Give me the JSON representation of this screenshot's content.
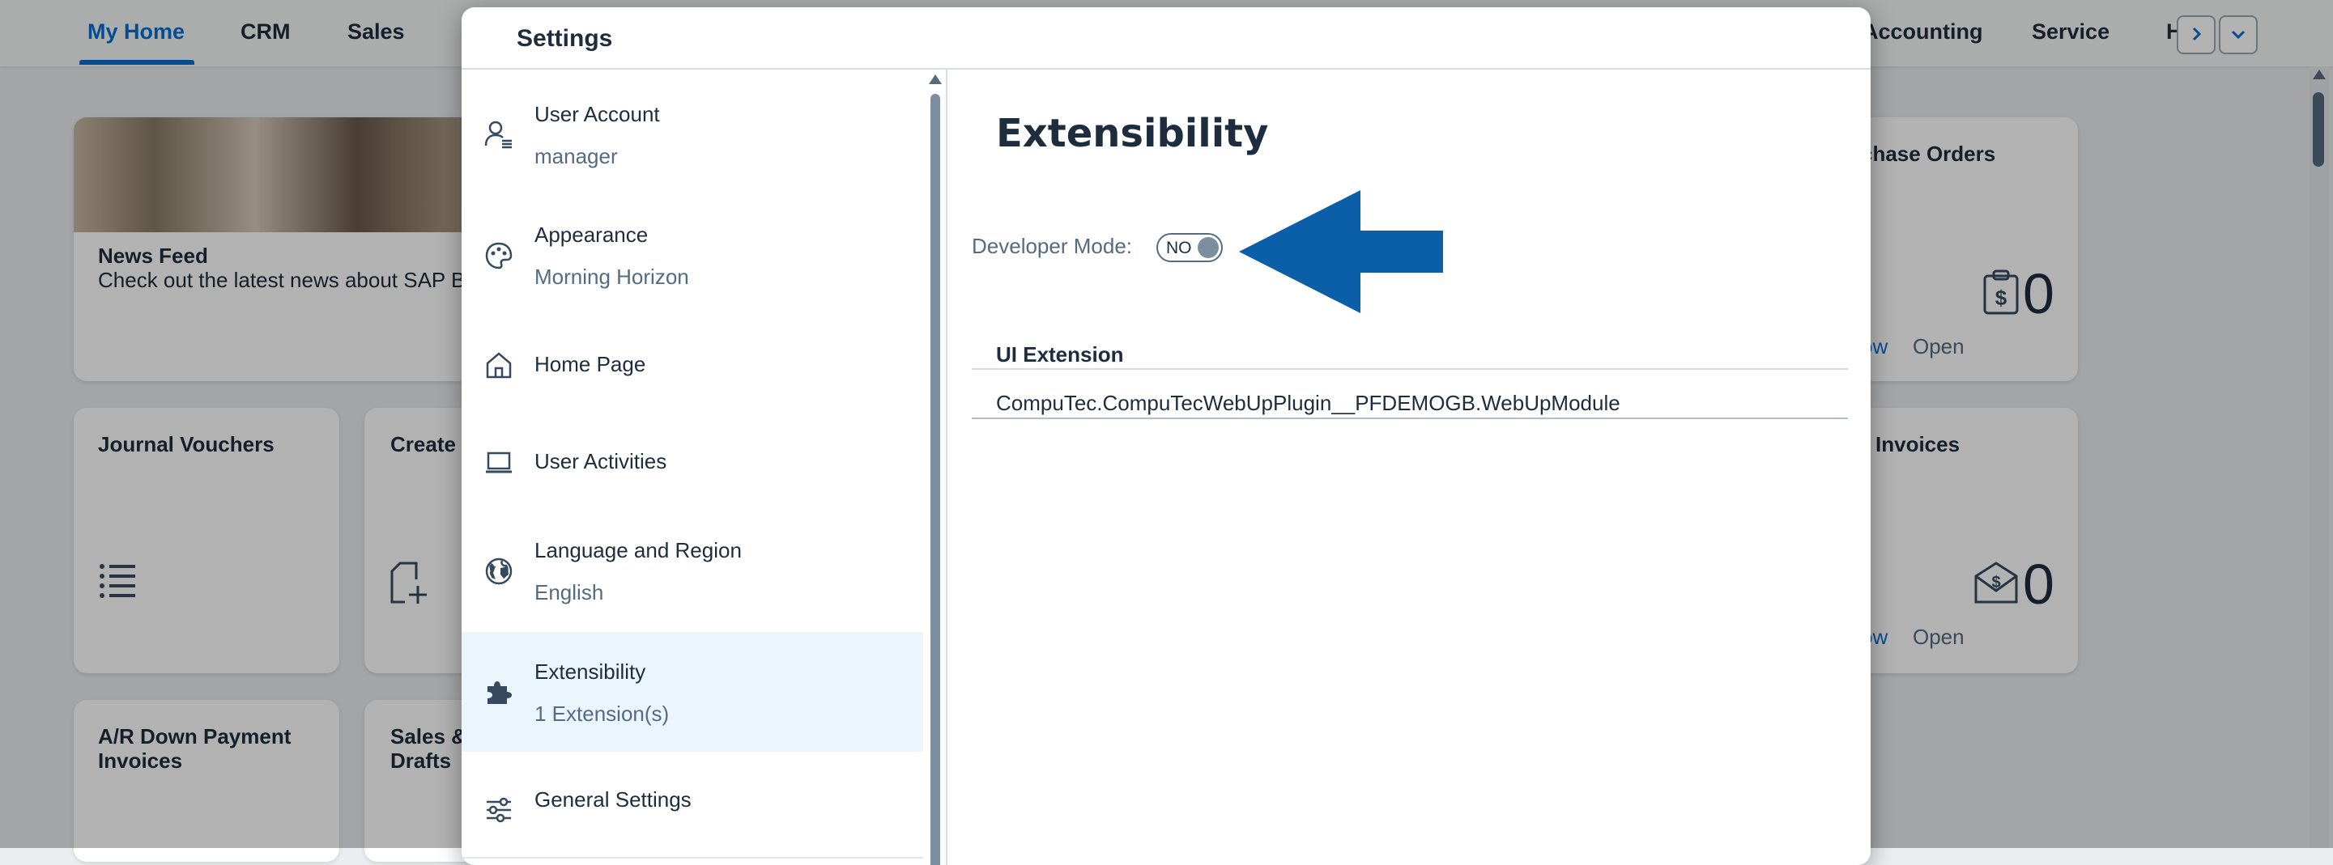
{
  "shell": {
    "tabs": [
      {
        "label": "My Home",
        "active": true
      },
      {
        "label": "CRM"
      },
      {
        "label": "Sales"
      },
      {
        "label": "Accounting"
      },
      {
        "label": "Service"
      },
      {
        "label": "H"
      }
    ],
    "nav_next_icon": "chevron-right-icon",
    "nav_more_icon": "chevron-down-icon"
  },
  "tiles": {
    "news": {
      "title": "News Feed",
      "subtitle": "Check out the latest news about SAP B"
    },
    "purchase_orders": {
      "title": "chase Orders",
      "value": "0",
      "link": "ow",
      "footer": "Open",
      "icon": "clipboard-dollar-icon"
    },
    "journal": {
      "title": "Journal Vouchers",
      "icon": "list-icon"
    },
    "create": {
      "title": "Create",
      "icon": "add-document-icon"
    },
    "invoices": {
      "title": "Invoices",
      "value": "0",
      "link": "ow",
      "footer": "Open",
      "icon": "envelope-dollar-icon"
    },
    "ar_down": {
      "title_line1": "A/R Down Payment",
      "title_line2": "Invoices"
    },
    "sales_drafts": {
      "title_line1": "Sales &",
      "title_line2": "Drafts"
    }
  },
  "dialog": {
    "title": "Settings",
    "nav": [
      {
        "title": "User Account",
        "desc": "manager",
        "icon": "user-settings-icon"
      },
      {
        "title": "Appearance",
        "desc": "Morning Horizon",
        "icon": "palette-icon"
      },
      {
        "title": "Home Page",
        "icon": "home-icon"
      },
      {
        "title": "User Activities",
        "icon": "laptop-icon"
      },
      {
        "title": "Language and Region",
        "desc": "English",
        "icon": "globe-icon"
      },
      {
        "title": "Extensibility",
        "desc": "1 Extension(s)",
        "icon": "puzzle-icon",
        "selected": true
      },
      {
        "title": "General Settings",
        "icon": "sliders-icon"
      }
    ],
    "content": {
      "title": "Extensibility",
      "developer_mode_label": "Developer Mode:",
      "developer_mode_value": "NO",
      "table": {
        "header": "UI Extension",
        "rows": [
          "CompuTec.CompuTecWebUpPlugin__PFDEMOGB.WebUpModule"
        ]
      }
    }
  },
  "colors": {
    "accent": "#0a6ed1",
    "arrow": "#0b5ea8",
    "text": "#1d2d3e",
    "muted": "#556b82"
  }
}
